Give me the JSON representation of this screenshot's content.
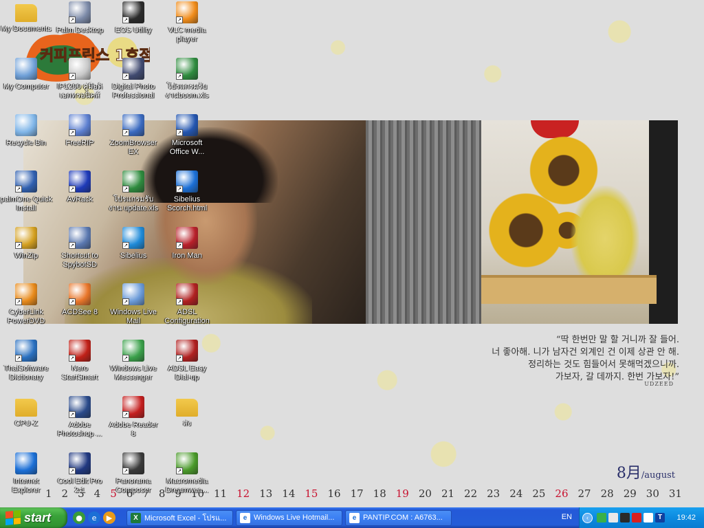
{
  "desktop": {
    "icons": [
      {
        "label": "My Documents",
        "icon": "folder-documents-icon"
      },
      {
        "label": "Palm Desktop",
        "icon": "palm-desktop-icon"
      },
      {
        "label": "EOS Utility",
        "icon": "eos-utility-icon"
      },
      {
        "label": "VLC media player",
        "icon": "vlc-cone-icon"
      },
      {
        "label": "My Computer",
        "icon": "computer-icon"
      },
      {
        "label": "IP1200 คู่มือดิ เอกทรอนิคส์",
        "icon": "printer-manual-icon"
      },
      {
        "label": "Digital Photo Professional",
        "icon": "digital-photo-icon"
      },
      {
        "label": "โปรแกรมรับ งานboom.xls",
        "icon": "excel-file-icon"
      },
      {
        "label": "Recycle Bin",
        "icon": "recycle-bin-icon"
      },
      {
        "label": "FreeRIP",
        "icon": "freerip-icon"
      },
      {
        "label": "ZoomBrowser EX",
        "icon": "zoombrowser-icon"
      },
      {
        "label": "Microsoft Office W...",
        "icon": "word-icon"
      },
      {
        "label": "palmOne Quick Install",
        "icon": "palm-install-icon"
      },
      {
        "label": "AvRack",
        "icon": "avrack-icon"
      },
      {
        "label": "โปรแกรมรับงาน update.xls",
        "icon": "excel-file-icon"
      },
      {
        "label": "Sibelius Scorch.html",
        "icon": "ie-html-icon"
      },
      {
        "label": "WinZip",
        "icon": "winzip-icon"
      },
      {
        "label": "Shortcut to SpybotSD",
        "icon": "spybot-icon"
      },
      {
        "label": "Sibelius",
        "icon": "sibelius-icon"
      },
      {
        "label": "Iron Man",
        "icon": "iron-man-icon"
      },
      {
        "label": "CyberLink PowerDVD",
        "icon": "powerdvd-icon"
      },
      {
        "label": "ACDSee 8",
        "icon": "acdsee-icon"
      },
      {
        "label": "Windows Live Mail",
        "icon": "live-mail-icon"
      },
      {
        "label": "ADSL Configuration",
        "icon": "adsl-network-icon"
      },
      {
        "label": "ThaiSoftware Dictionary",
        "icon": "dictionary-globe-icon"
      },
      {
        "label": "Nero StartSmart",
        "icon": "nero-icon"
      },
      {
        "label": "Windows Live Messenger",
        "icon": "messenger-icon"
      },
      {
        "label": "ADSL Easy Dial-up",
        "icon": "adsl-network-icon"
      },
      {
        "label": "CPU-Z",
        "icon": "folder-icon"
      },
      {
        "label": "Adobe Photoshop ...",
        "icon": "photoshop-icon"
      },
      {
        "label": "Adobe Reader 8",
        "icon": "adobe-reader-icon"
      },
      {
        "label": "ส่ง",
        "icon": "folder-icon"
      },
      {
        "label": "Internet Explorer",
        "icon": "internet-explorer-icon"
      },
      {
        "label": "Cool Edit Pro 2.1",
        "icon": "cool-edit-icon"
      },
      {
        "label": "Panorama Composer",
        "icon": "panorama-icon"
      },
      {
        "label": "Macromedia Dreamwea...",
        "icon": "dreamweaver-icon"
      }
    ]
  },
  "wallpaper": {
    "logo_text": "커피프린스 1호점",
    "quote_lines": [
      "“딱 한번만 말 할 거니까 잘 들어.",
      "너 좋아해. 니가 남자건 외계인 건 이제 상관 안 해.",
      "정리하는 것도 힘들어서 못해먹겠으니까.",
      "가보자, 갈 데까지. 한번 가보자!”"
    ],
    "quote_sign": "UDZEED",
    "month_num": "8月",
    "month_en": "/august",
    "days": [
      {
        "d": "1",
        "red": false
      },
      {
        "d": "2",
        "red": false
      },
      {
        "d": "3",
        "red": false
      },
      {
        "d": "4",
        "red": false
      },
      {
        "d": "5",
        "red": true
      },
      {
        "d": "6",
        "red": false
      },
      {
        "d": "7",
        "red": false
      },
      {
        "d": "8",
        "red": false
      },
      {
        "d": "9",
        "red": false
      },
      {
        "d": "10",
        "red": false
      },
      {
        "d": "11",
        "red": false
      },
      {
        "d": "12",
        "red": true
      },
      {
        "d": "13",
        "red": false
      },
      {
        "d": "14",
        "red": false
      },
      {
        "d": "15",
        "red": true
      },
      {
        "d": "16",
        "red": false
      },
      {
        "d": "17",
        "red": false
      },
      {
        "d": "18",
        "red": false
      },
      {
        "d": "19",
        "red": true
      },
      {
        "d": "20",
        "red": false
      },
      {
        "d": "21",
        "red": false
      },
      {
        "d": "22",
        "red": false
      },
      {
        "d": "23",
        "red": false
      },
      {
        "d": "24",
        "red": false
      },
      {
        "d": "25",
        "red": false
      },
      {
        "d": "26",
        "red": true
      },
      {
        "d": "27",
        "red": false
      },
      {
        "d": "28",
        "red": false
      },
      {
        "d": "29",
        "red": false
      },
      {
        "d": "30",
        "red": false
      },
      {
        "d": "31",
        "red": false
      }
    ]
  },
  "taskbar": {
    "start_label": "start",
    "quicklaunch": [
      "msn-icon",
      "internet-explorer-icon",
      "media-player-icon"
    ],
    "tasks": [
      {
        "label": "Microsoft Excel - โปรแ...",
        "icon": "excel-icon"
      },
      {
        "label": "Windows Live Hotmail...",
        "icon": "internet-explorer-icon"
      },
      {
        "label": "PANTIP.COM : A6763...",
        "icon": "internet-explorer-icon"
      }
    ],
    "language": "EN",
    "clock": "19:42"
  },
  "colors": {
    "taskbar_blue": "#245dd8",
    "start_green": "#3aa33a",
    "tray_blue": "#0d8be0",
    "calendar_red": "#c8102e"
  }
}
